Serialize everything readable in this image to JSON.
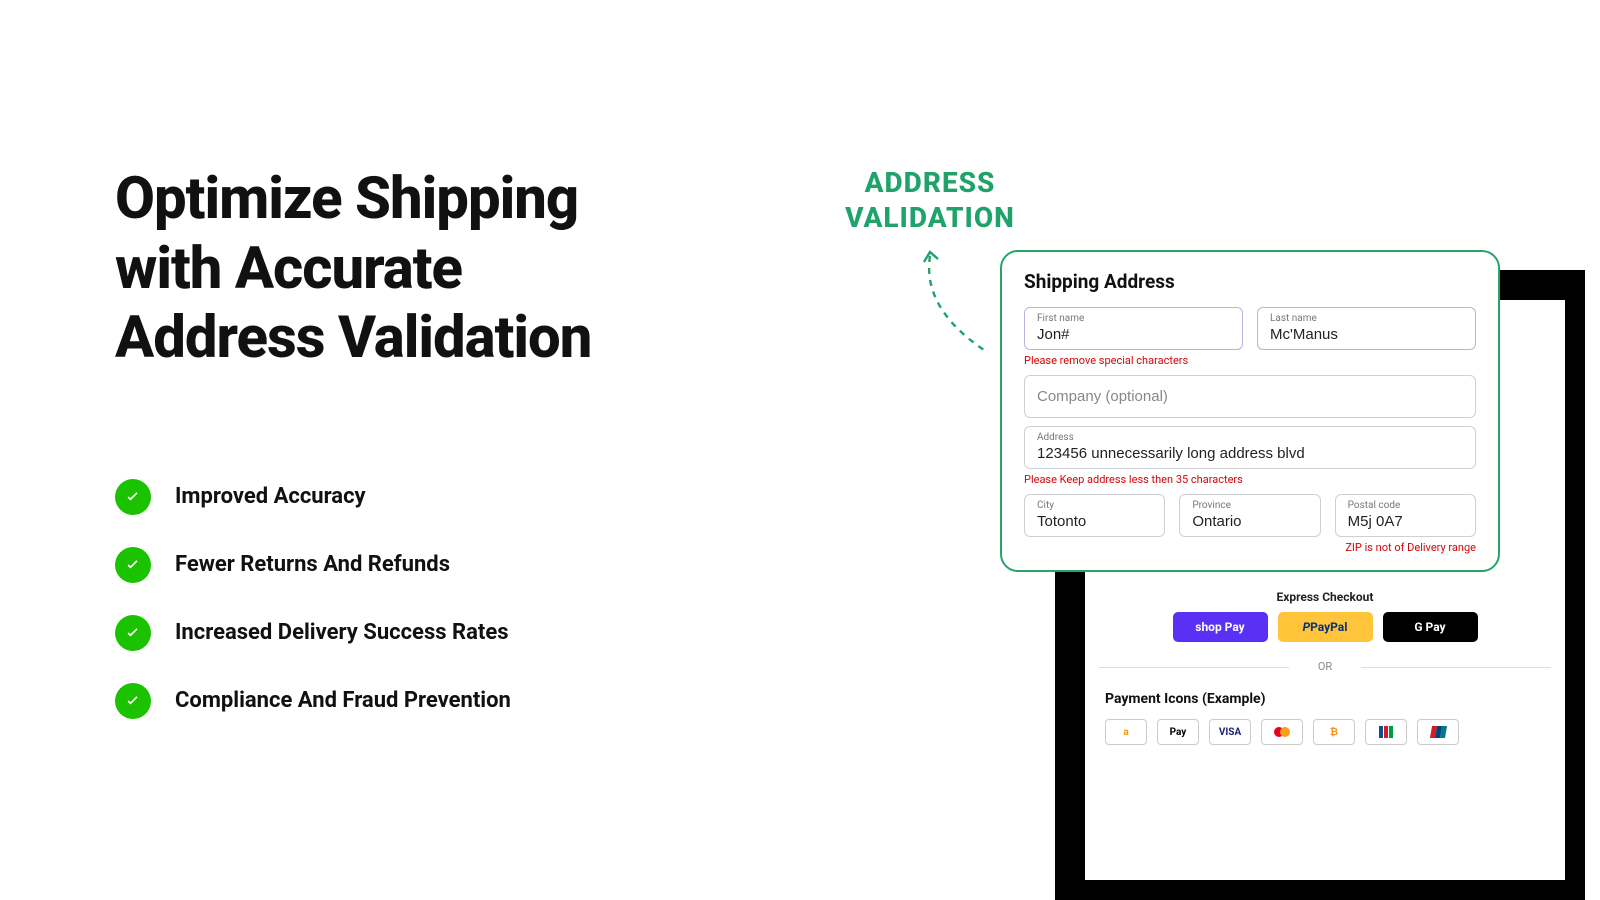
{
  "hero": {
    "title": "Optimize Shipping with Accurate Address Validation"
  },
  "benefits": [
    "Improved Accuracy",
    "Fewer Returns And Refunds",
    "Increased Delivery Success Rates",
    "Compliance And Fraud Prevention"
  ],
  "callout": {
    "label": "ADDRESS VALIDATION"
  },
  "card": {
    "title": "Shipping Address",
    "first_name_label": "First name",
    "first_name_value": "Jon#",
    "last_name_label": "Last name",
    "last_name_value": "Mc'Manus",
    "name_error": "Please remove special characters",
    "company_placeholder": "Company (optional)",
    "address_label": "Address",
    "address_value": "123456 unnecessarily long address blvd",
    "address_error": "Please Keep address less then 35 characters",
    "city_label": "City",
    "city_value": "Totonto",
    "province_label": "Province",
    "province_value": "Ontario",
    "postal_label": "Postal code",
    "postal_value": "M5j 0A7",
    "zip_error": "ZIP is not of Delivery range"
  },
  "checkout": {
    "express_label": "Express Checkout",
    "shop_pay": "shop Pay",
    "paypal": "PayPal",
    "gpay": "G Pay",
    "or": "OR",
    "payment_icons_title": "Payment Icons (Example)",
    "icons": [
      "a",
      "Pay",
      "VISA",
      "mc",
      "btc",
      "jcb",
      "up"
    ]
  },
  "colors": {
    "accent_green": "#1bc200",
    "brand_green": "#27a36c",
    "error": "#d30707",
    "shop_pay": "#5a31f4",
    "paypal": "#ffc439"
  }
}
